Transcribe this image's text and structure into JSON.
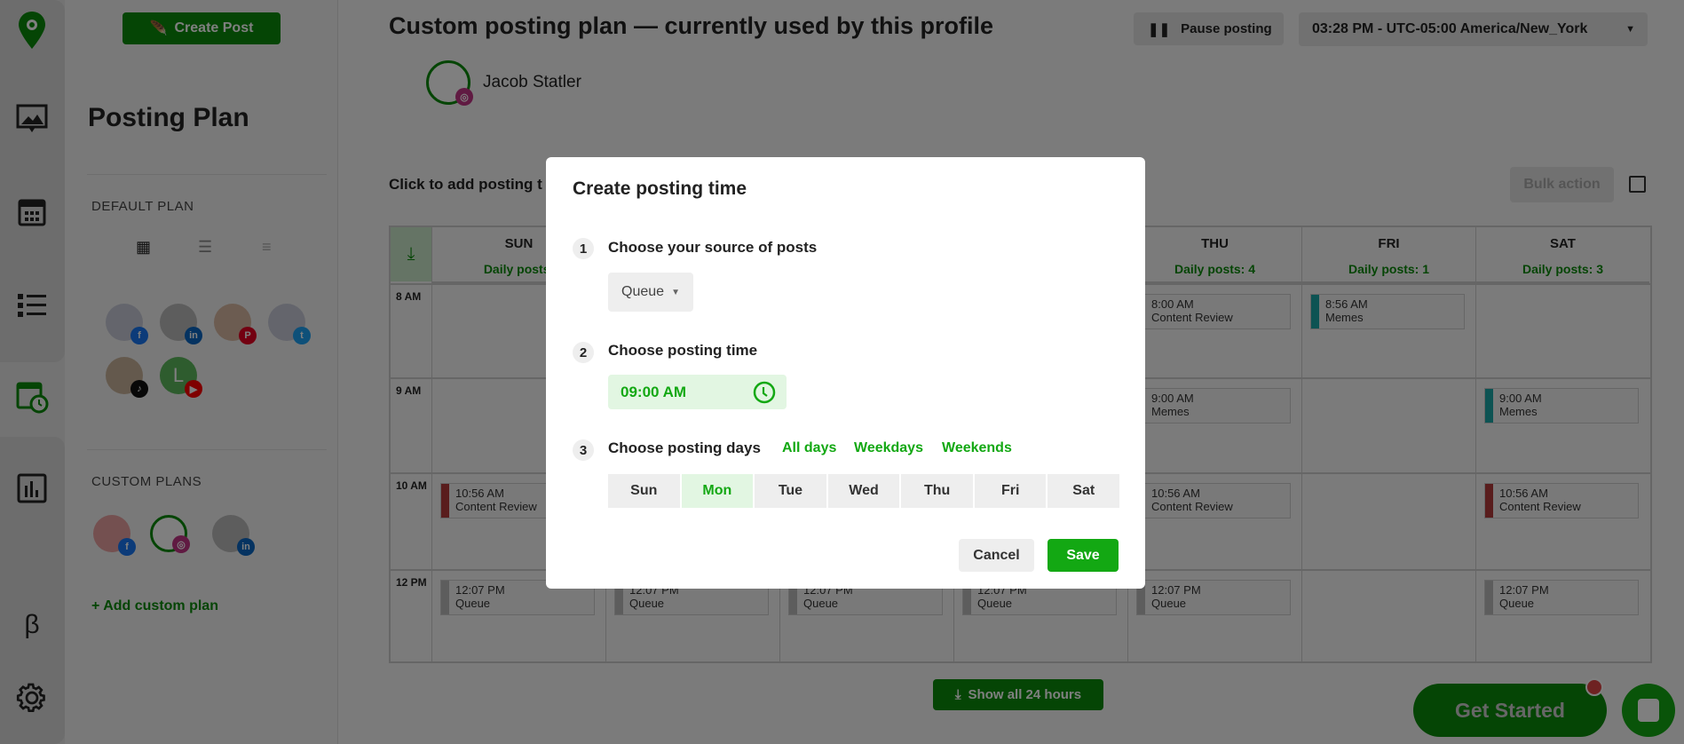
{
  "rail": {
    "icons": [
      "logo-pin-icon",
      "media-icon",
      "calendar-icon",
      "list-icon",
      "posting-plan-icon",
      "analytics-icon",
      "beta-icon",
      "gear-icon"
    ],
    "beta": "β"
  },
  "sidebar": {
    "create_post": "Create Post",
    "title": "Posting Plan",
    "default_plan": "DEFAULT PLAN",
    "custom_plans": "CUSTOM PLANS",
    "add_custom_plan": "+ Add custom plan"
  },
  "header": {
    "title": "Custom posting plan — currently used by this profile",
    "profile_name": "Jacob Statler",
    "pause": "Pause posting",
    "timezone": "03:28 PM - UTC-05:00 America/New_York",
    "click_hint": "Click to add posting t",
    "bulk_action": "Bulk action"
  },
  "calendar": {
    "days": [
      {
        "name": "SUN",
        "posts": "Daily posts:"
      },
      {
        "name": "",
        "posts": ""
      },
      {
        "name": "",
        "posts": ""
      },
      {
        "name": "",
        "posts": ""
      },
      {
        "name": "THU",
        "posts": "Daily posts: 4"
      },
      {
        "name": "FRI",
        "posts": "Daily posts: 1"
      },
      {
        "name": "SAT",
        "posts": "Daily posts: 3"
      }
    ],
    "hours": [
      "8 AM",
      "9 AM",
      "10 AM",
      "12 PM"
    ],
    "entries": [
      {
        "day": 0,
        "hour": 2,
        "time": "10:56 AM",
        "label": "Content Review",
        "color": "#b33a3a"
      },
      {
        "day": 0,
        "hour": 3,
        "time": "12:07 PM",
        "label": "Queue",
        "color": "#bbbbbb"
      },
      {
        "day": 1,
        "hour": 3,
        "time": "12:07 PM",
        "label": "Queue",
        "color": "#bbbbbb"
      },
      {
        "day": 2,
        "hour": 3,
        "time": "12:07 PM",
        "label": "Queue",
        "color": "#bbbbbb"
      },
      {
        "day": 3,
        "hour": 3,
        "time": "12:07 PM",
        "label": "Queue",
        "color": "#bbbbbb"
      },
      {
        "day": 4,
        "hour": 0,
        "time": "8:00 AM",
        "label": "Content Review",
        "color": "#b33a3a"
      },
      {
        "day": 4,
        "hour": 1,
        "time": "9:00 AM",
        "label": "Memes",
        "color": "#1aa7a7"
      },
      {
        "day": 4,
        "hour": 2,
        "time": "10:56 AM",
        "label": "Content Review",
        "color": "#b33a3a"
      },
      {
        "day": 4,
        "hour": 3,
        "time": "12:07 PM",
        "label": "Queue",
        "color": "#bbbbbb"
      },
      {
        "day": 5,
        "hour": 0,
        "time": "8:56 AM",
        "label": "Memes",
        "color": "#1aa7a7"
      },
      {
        "day": 6,
        "hour": 1,
        "time": "9:00 AM",
        "label": "Memes",
        "color": "#1aa7a7"
      },
      {
        "day": 6,
        "hour": 2,
        "time": "10:56 AM",
        "label": "Content Review",
        "color": "#b33a3a"
      },
      {
        "day": 6,
        "hour": 3,
        "time": "12:07 PM",
        "label": "Queue",
        "color": "#bbbbbb"
      }
    ],
    "show_all": "Show all 24 hours"
  },
  "modal": {
    "title": "Create posting time",
    "step1": "Choose your source of posts",
    "source": "Queue",
    "step2": "Choose posting time",
    "time": "09:00 AM",
    "step3": "Choose posting days",
    "all_days": "All days",
    "weekdays": "Weekdays",
    "weekends": "Weekends",
    "days": [
      {
        "label": "Sun",
        "selected": false
      },
      {
        "label": "Mon",
        "selected": true
      },
      {
        "label": "Tue",
        "selected": false
      },
      {
        "label": "Wed",
        "selected": false
      },
      {
        "label": "Thu",
        "selected": false
      },
      {
        "label": "Fri",
        "selected": false
      },
      {
        "label": "Sat",
        "selected": false
      }
    ],
    "cancel": "Cancel",
    "save": "Save"
  },
  "get_started": "Get Started",
  "colors": {
    "accent": "#13a813",
    "dark_green": "#0b8a0b"
  }
}
